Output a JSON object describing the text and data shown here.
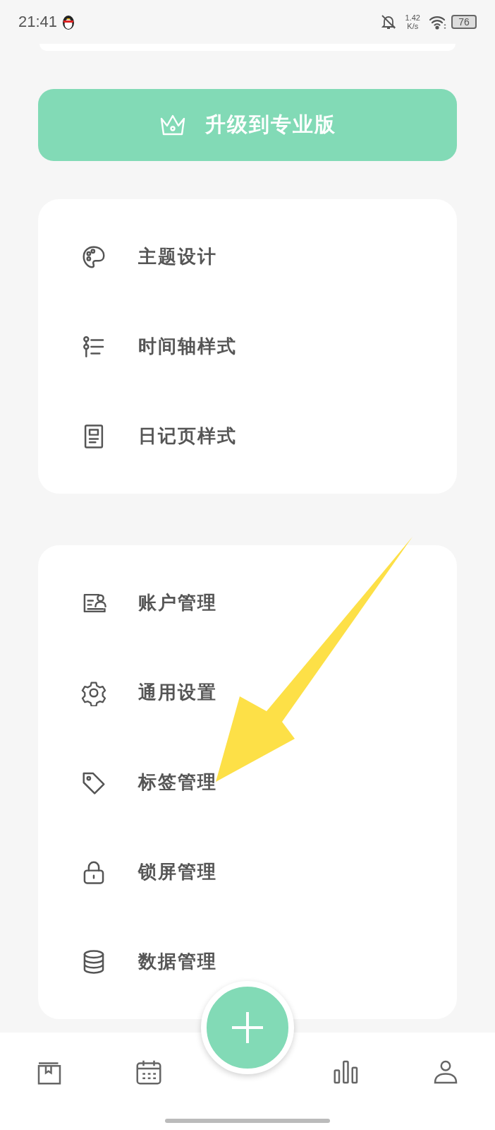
{
  "status_bar": {
    "time": "21:41",
    "net_speed": "1.42",
    "net_unit": "K/s",
    "battery": "76"
  },
  "upgrade_button": {
    "label": "升级到专业版"
  },
  "sections": [
    {
      "items": [
        {
          "label": "主题设计"
        },
        {
          "label": "时间轴样式"
        },
        {
          "label": "日记页样式"
        }
      ]
    },
    {
      "items": [
        {
          "label": "账户管理"
        },
        {
          "label": "通用设置"
        },
        {
          "label": "标签管理"
        },
        {
          "label": "锁屏管理"
        },
        {
          "label": "数据管理"
        }
      ]
    }
  ]
}
